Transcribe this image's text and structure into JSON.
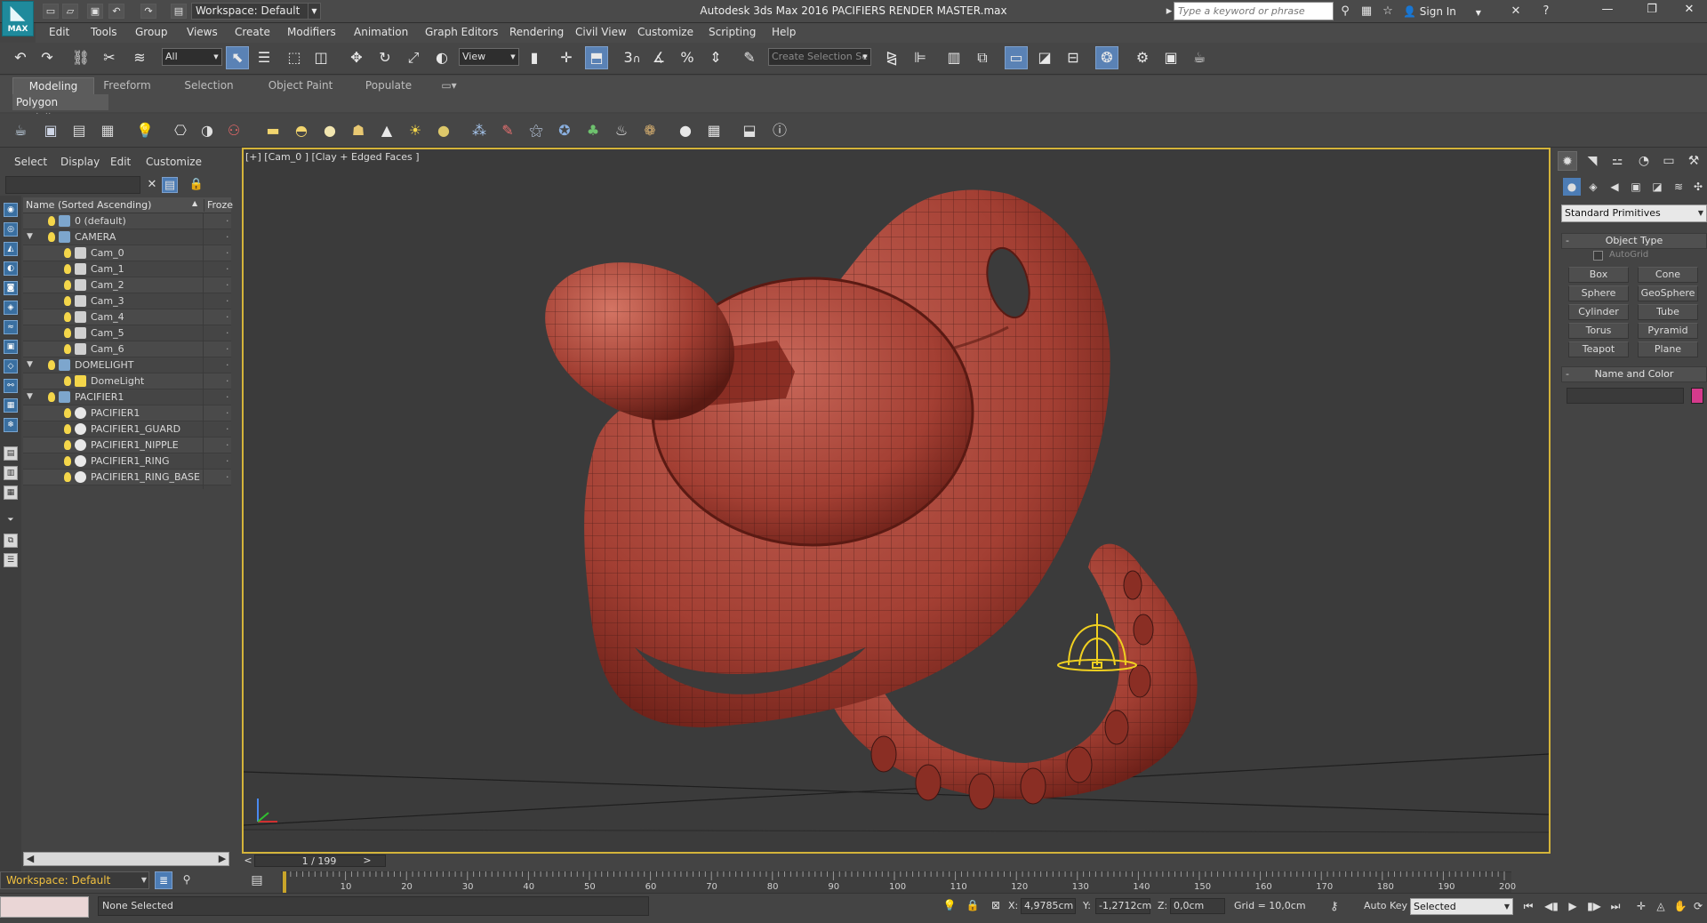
{
  "app": {
    "logo_text": "MAX",
    "title": "Autodesk 3ds Max 2016     PACIFIERS RENDER MASTER.max",
    "workspace": "Workspace: Default",
    "search_placeholder": "Type a keyword or phrase",
    "sign_in": "Sign In"
  },
  "menu": [
    "Edit",
    "Tools",
    "Group",
    "Views",
    "Create",
    "Modifiers",
    "Animation",
    "Graph Editors",
    "Rendering",
    "Civil View",
    "Customize",
    "Scripting",
    "Help"
  ],
  "main_toolbar": {
    "selection_filter": "All",
    "ref_coord": "View",
    "named_selection": "Create Selection Se",
    "snap_labels": [
      "3",
      "%"
    ]
  },
  "ribbon": {
    "tabs": [
      "Modeling",
      "Freeform",
      "Selection",
      "Object Paint",
      "Populate"
    ],
    "active_panel": "Polygon Modeling"
  },
  "scene_explorer": {
    "menu": [
      "Select",
      "Display",
      "Edit",
      "Customize"
    ],
    "col_name": "Name (Sorted Ascending)",
    "col_frozen": "Froze",
    "rows": [
      {
        "name": "0 (default)",
        "level": 0,
        "type": "layer",
        "toggle": ""
      },
      {
        "name": "CAMERA",
        "level": 0,
        "type": "layer",
        "toggle": "▼"
      },
      {
        "name": "Cam_0",
        "level": 1,
        "type": "cam",
        "toggle": ""
      },
      {
        "name": "Cam_1",
        "level": 1,
        "type": "cam",
        "toggle": ""
      },
      {
        "name": "Cam_2",
        "level": 1,
        "type": "cam",
        "toggle": ""
      },
      {
        "name": "Cam_3",
        "level": 1,
        "type": "cam",
        "toggle": ""
      },
      {
        "name": "Cam_4",
        "level": 1,
        "type": "cam",
        "toggle": ""
      },
      {
        "name": "Cam_5",
        "level": 1,
        "type": "cam",
        "toggle": ""
      },
      {
        "name": "Cam_6",
        "level": 1,
        "type": "cam",
        "toggle": ""
      },
      {
        "name": "DOMELIGHT",
        "level": 0,
        "type": "layer",
        "toggle": "▼"
      },
      {
        "name": "DomeLight",
        "level": 1,
        "type": "light",
        "toggle": ""
      },
      {
        "name": "PACIFIER1",
        "level": 0,
        "type": "layer",
        "toggle": "▼"
      },
      {
        "name": "PACIFIER1",
        "level": 1,
        "type": "geo",
        "toggle": ""
      },
      {
        "name": "PACIFIER1_GUARD",
        "level": 1,
        "type": "geo",
        "toggle": ""
      },
      {
        "name": "PACIFIER1_NIPPLE",
        "level": 1,
        "type": "geo",
        "toggle": ""
      },
      {
        "name": "PACIFIER1_RING",
        "level": 1,
        "type": "geo",
        "toggle": ""
      },
      {
        "name": "PACIFIER1_RING_BASE",
        "level": 1,
        "type": "geo",
        "toggle": ""
      }
    ],
    "workspace_footer": "Workspace: Default"
  },
  "viewport": {
    "label": "[+] [Cam_0 ] [Clay + Edged Faces ]",
    "model_color": "#b54a3e",
    "border_color": "#d4b43a"
  },
  "command_panel": {
    "category": "Standard Primitives",
    "object_type_title": "Object Type",
    "autogrid": "AutoGrid",
    "primitives": [
      "Box",
      "Cone",
      "Sphere",
      "GeoSphere",
      "Cylinder",
      "Tube",
      "Torus",
      "Pyramid",
      "Teapot",
      "Plane"
    ],
    "name_color_title": "Name and Color",
    "swatch_color": "#d63a8c"
  },
  "timeline": {
    "frame_display": "1 / 199",
    "ticks": [
      "10",
      "20",
      "30",
      "40",
      "50",
      "60",
      "70",
      "80",
      "90",
      "100",
      "110",
      "120",
      "130",
      "140",
      "150",
      "160",
      "170",
      "180",
      "190",
      "200"
    ]
  },
  "status": {
    "message": "None Selected",
    "x_label": "X:",
    "x_value": "4,9785cm",
    "y_label": "Y:",
    "y_value": "-1,2712cm",
    "z_label": "Z:",
    "z_value": "0,0cm",
    "grid": "Grid = 10,0cm",
    "auto_key": "Auto Key",
    "key_filter": "Selected"
  }
}
